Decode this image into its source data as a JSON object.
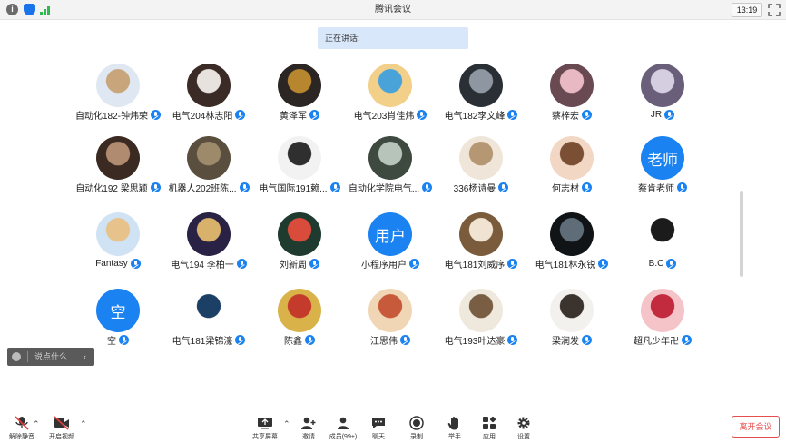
{
  "window": {
    "title": "腾讯会议",
    "time": "13:19"
  },
  "status_icons": [
    "info-icon",
    "shield-icon",
    "signal-icon"
  ],
  "speaking": {
    "label": "正在讲话:"
  },
  "participants": [
    {
      "name": "自动化182-钟炜荣",
      "avatar": {
        "type": "photo",
        "colors": [
          "#dfe8f2",
          "#c9a57c"
        ]
      }
    },
    {
      "name": "电气204林志阳",
      "avatar": {
        "type": "photo",
        "colors": [
          "#3b2b26",
          "#e7e2dd"
        ]
      }
    },
    {
      "name": "黄泽军",
      "avatar": {
        "type": "photo",
        "colors": [
          "#2b2624",
          "#b8862f"
        ]
      }
    },
    {
      "name": "电气203肖佳炜",
      "avatar": {
        "type": "photo",
        "colors": [
          "#f2d08a",
          "#4aa3d8"
        ]
      }
    },
    {
      "name": "电气182李文峰",
      "avatar": {
        "type": "photo",
        "colors": [
          "#2a2f36",
          "#8d96a1"
        ]
      }
    },
    {
      "name": "蔡梓宏",
      "avatar": {
        "type": "photo",
        "colors": [
          "#6a4a52",
          "#e9b9c3"
        ]
      }
    },
    {
      "name": "JR",
      "avatar": {
        "type": "photo",
        "colors": [
          "#6a5f7a",
          "#d5cde0"
        ]
      }
    },
    {
      "name": "自动化192 梁思颖",
      "avatar": {
        "type": "photo",
        "colors": [
          "#3a2a22",
          "#b08b70"
        ]
      }
    },
    {
      "name": "机器人202班陈...",
      "avatar": {
        "type": "photo",
        "colors": [
          "#5a4e3e",
          "#9c8a6a"
        ]
      }
    },
    {
      "name": "电气国际191赖...",
      "avatar": {
        "type": "photo",
        "colors": [
          "#f2f2f2",
          "#2f2f2f"
        ]
      }
    },
    {
      "name": "自动化学院电气...",
      "avatar": {
        "type": "photo",
        "colors": [
          "#3e4a40",
          "#b7c4b9"
        ]
      }
    },
    {
      "name": "336杨诗曼",
      "avatar": {
        "type": "photo",
        "colors": [
          "#efe6d9",
          "#b59774"
        ]
      }
    },
    {
      "name": "何志材",
      "avatar": {
        "type": "photo",
        "colors": [
          "#f2d7c4",
          "#7a4f34"
        ]
      }
    },
    {
      "name": "蔡肯老师",
      "avatar": {
        "type": "text",
        "text": "老师",
        "color": "#1b82f1"
      }
    },
    {
      "name": "Fantasy",
      "avatar": {
        "type": "photo",
        "colors": [
          "#cfe3f4",
          "#e7c28a"
        ]
      }
    },
    {
      "name": "电气194 李柏一",
      "avatar": {
        "type": "photo",
        "colors": [
          "#2a2244",
          "#d8b16a"
        ]
      }
    },
    {
      "name": "刘新周",
      "avatar": {
        "type": "photo",
        "colors": [
          "#1f3b2f",
          "#d94b3b"
        ]
      }
    },
    {
      "name": "小程序用户",
      "avatar": {
        "type": "text",
        "text": "用户",
        "color": "#1b82f1"
      }
    },
    {
      "name": "电气181刘威序",
      "avatar": {
        "type": "photo",
        "colors": [
          "#7a5b3c",
          "#f1e3d1"
        ]
      }
    },
    {
      "name": "电气181林永锐",
      "avatar": {
        "type": "photo",
        "colors": [
          "#111417",
          "#5f6d79"
        ]
      }
    },
    {
      "name": "B.C",
      "avatar": {
        "type": "photo",
        "colors": [
          "#ffffff",
          "#1b1b1b"
        ]
      }
    },
    {
      "name": "空",
      "avatar": {
        "type": "text",
        "text": "空",
        "color": "#1b82f1"
      }
    },
    {
      "name": "电气181梁锦濠",
      "avatar": {
        "type": "logo",
        "colors": [
          "#ffffff",
          "#1c3f66"
        ]
      }
    },
    {
      "name": "陈鑫",
      "avatar": {
        "type": "photo",
        "colors": [
          "#d9b34a",
          "#c43b2b"
        ]
      }
    },
    {
      "name": "江思伟",
      "avatar": {
        "type": "photo",
        "colors": [
          "#f0d6b4",
          "#c75a3a"
        ]
      }
    },
    {
      "name": "电气193叶达豪",
      "avatar": {
        "type": "photo",
        "colors": [
          "#efe8dc",
          "#7a5e44"
        ]
      }
    },
    {
      "name": "梁润发",
      "avatar": {
        "type": "photo",
        "colors": [
          "#f3f1ee",
          "#3b332d"
        ]
      }
    },
    {
      "name": "超凡少年卍",
      "avatar": {
        "type": "photo",
        "colors": [
          "#f4c4c8",
          "#c22a3d"
        ]
      }
    }
  ],
  "chat": {
    "placeholder": "说点什么...",
    "collapse": "‹"
  },
  "toolbar": {
    "mute": "解除静音",
    "video": "开启视频",
    "share": "共享屏幕",
    "invite": "邀请",
    "members": "成员(99+)",
    "chat": "聊天",
    "record": "录制",
    "raise": "举手",
    "apps": "应用",
    "settings": "设置",
    "leave": "离开会议"
  }
}
